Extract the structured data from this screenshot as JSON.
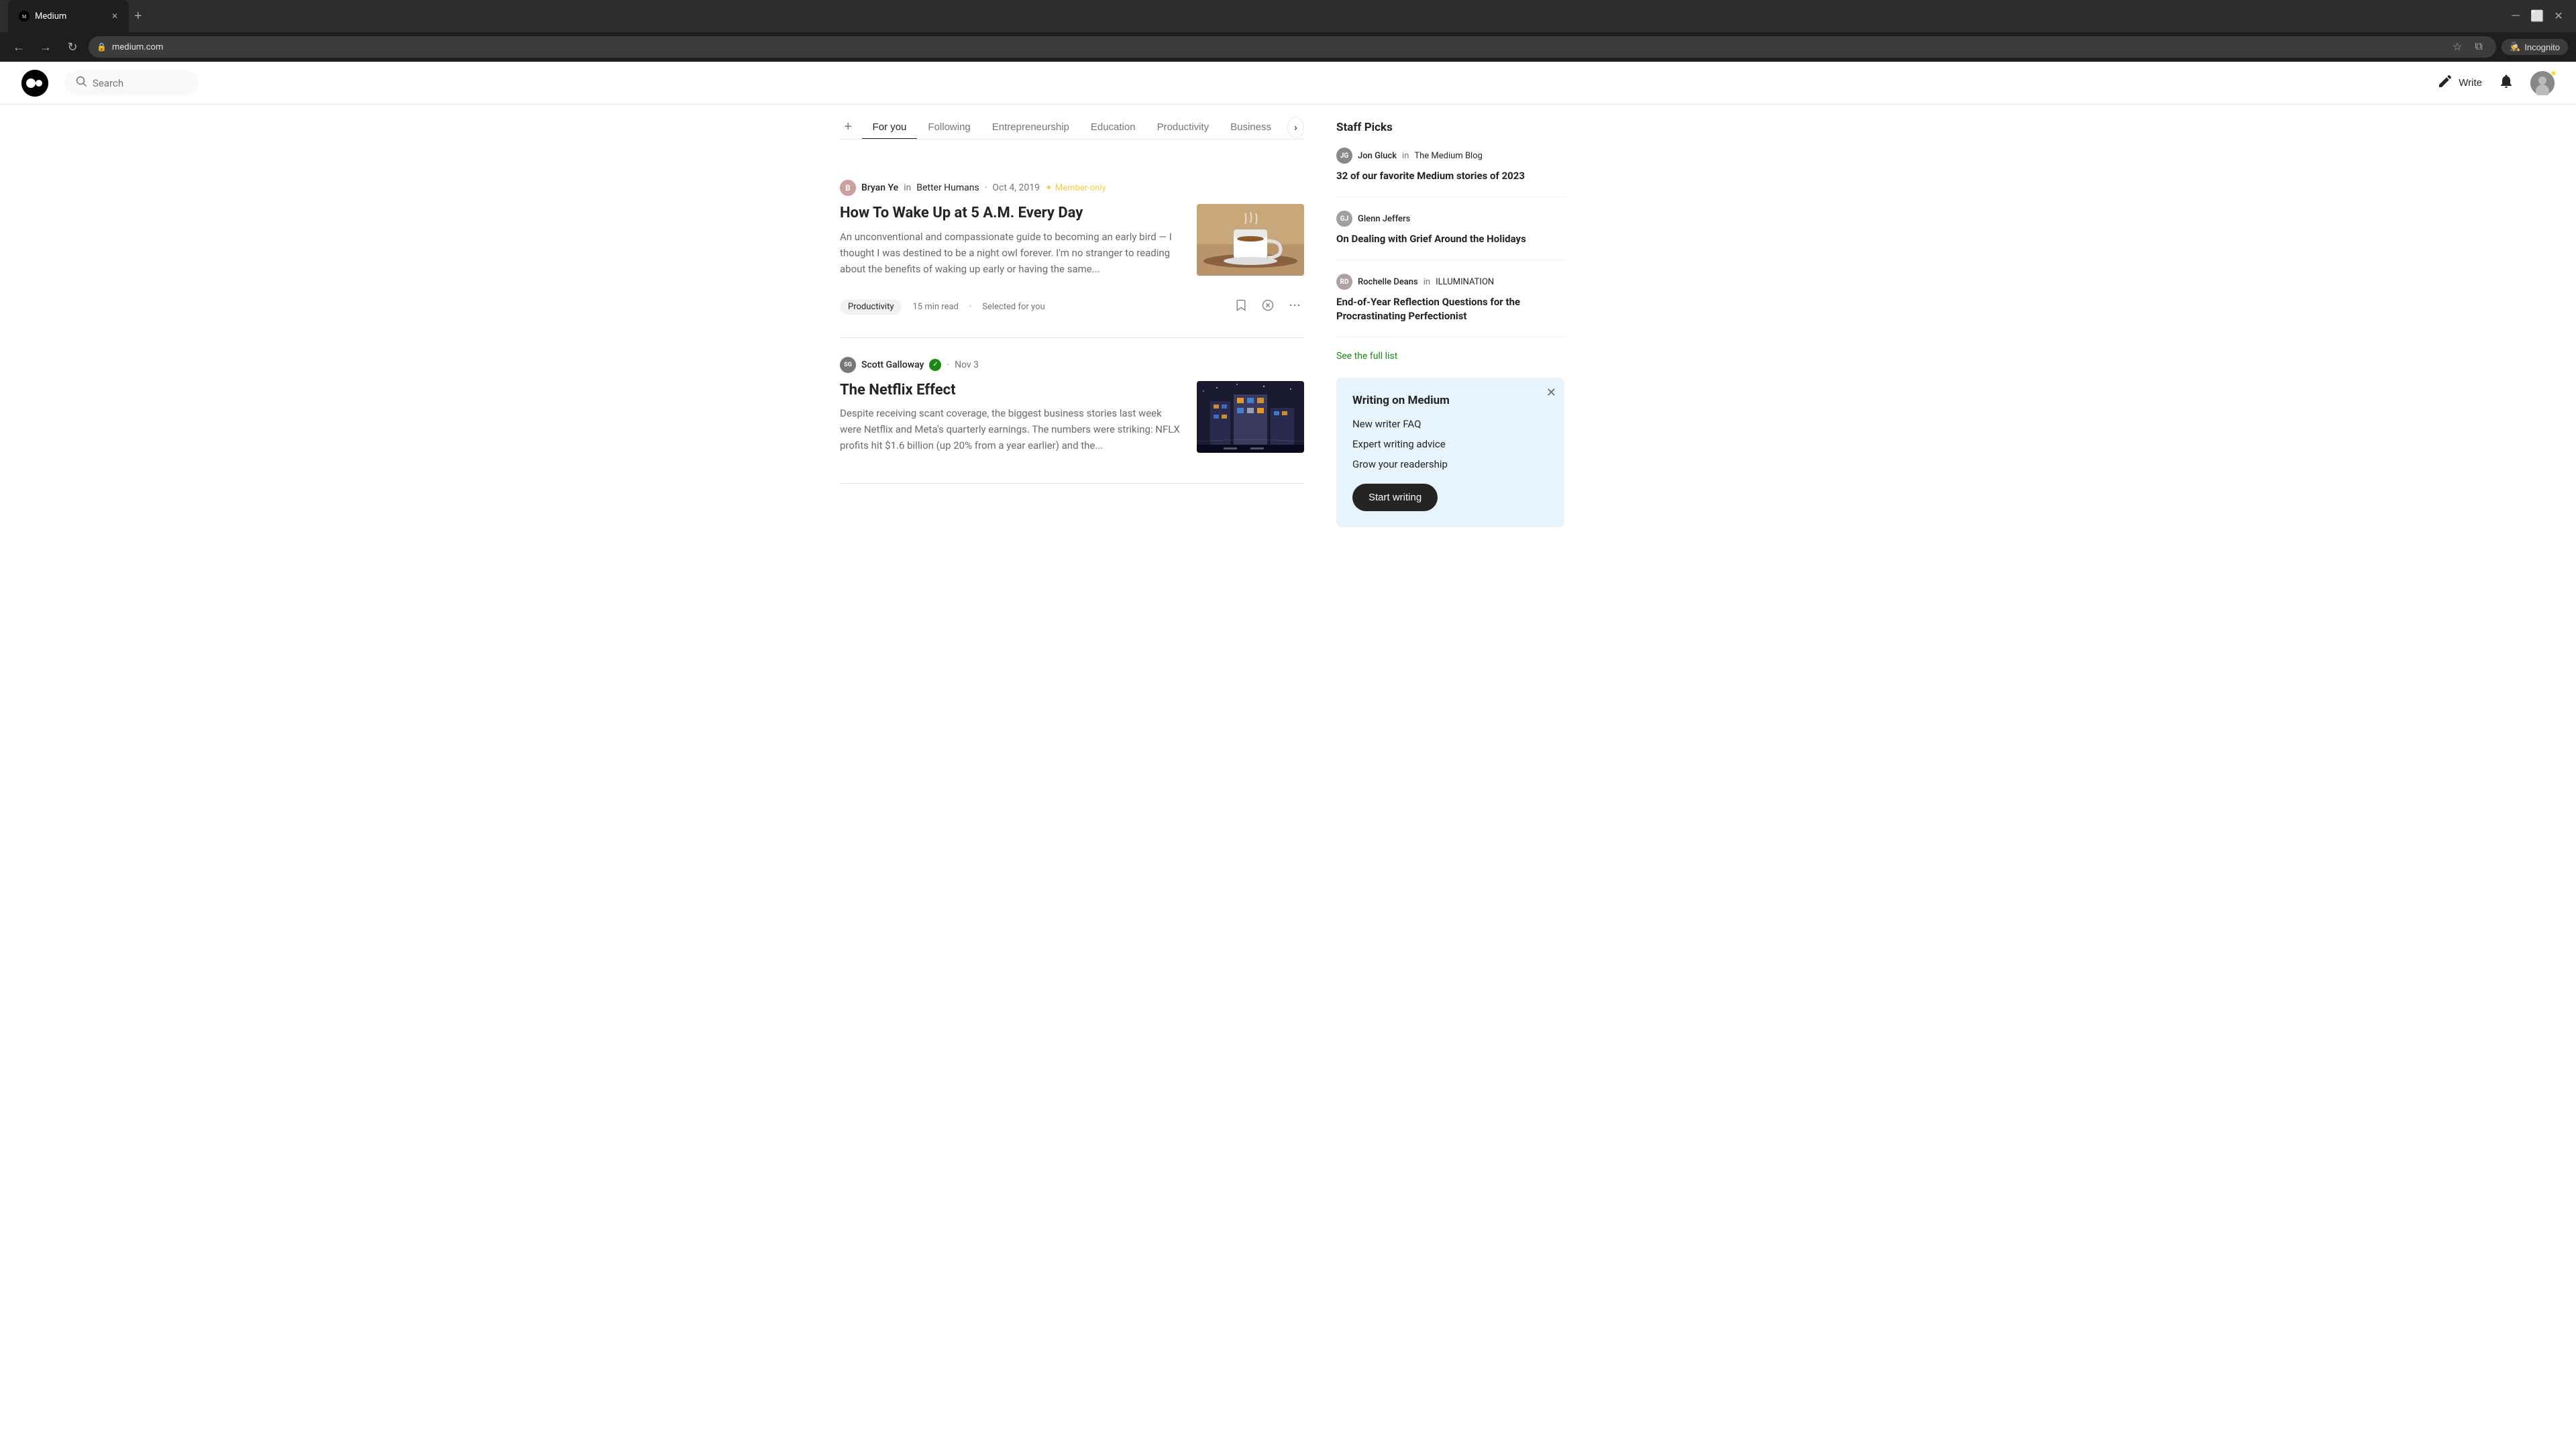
{
  "browser": {
    "tab_title": "Medium",
    "tab_favicon": "M",
    "url": "medium.com",
    "url_display": "medium.com",
    "incognito_label": "Incognito",
    "new_tab_label": "+"
  },
  "nav": {
    "search_placeholder": "Search",
    "write_label": "Write",
    "logo_mark": "M"
  },
  "feed_tabs": {
    "add_label": "+",
    "tabs": [
      {
        "label": "For you",
        "active": true
      },
      {
        "label": "Following",
        "active": false
      },
      {
        "label": "Entrepreneurship",
        "active": false
      },
      {
        "label": "Education",
        "active": false
      },
      {
        "label": "Productivity",
        "active": false
      },
      {
        "label": "Business",
        "active": false
      }
    ],
    "next_arrow": "›"
  },
  "articles": [
    {
      "author": "Bryan Ye",
      "author_initial": "B",
      "publication": "Better Humans",
      "date": "Oct 4, 2019",
      "member_badge": "Member-only",
      "title": "How To Wake Up at 5 A.M. Every Day",
      "excerpt": "An unconventional and compassionate guide to becoming an early bird — I thought I was destined to be a night owl forever. I'm no stranger to reading about the benefits of waking up early or having the same...",
      "tag": "Productivity",
      "read_time": "15 min read",
      "selected": "Selected for you",
      "dot_separator": "·"
    },
    {
      "author": "Scott Galloway",
      "author_initial": "SG",
      "publication": "",
      "date": "Nov 3",
      "verified": true,
      "title": "The Netflix Effect",
      "excerpt": "Despite receiving scant coverage, the biggest business stories last week were Netflix and Meta's quarterly earnings. The numbers were striking: NFLX profits hit $1.6 billion (up 20% from a year earlier) and the...",
      "tag": "",
      "read_time": "",
      "selected": ""
    }
  ],
  "sidebar": {
    "staff_picks_title": "Staff Picks",
    "picks": [
      {
        "author": "Jon Gluck",
        "author_initial": "JG",
        "pub_connector": "in",
        "publication": "The Medium Blog",
        "title": "32 of our favorite Medium stories of 2023",
        "avatar_bg": "#888"
      },
      {
        "author": "Glenn Jeffers",
        "author_initial": "GJ",
        "pub_connector": "",
        "publication": "",
        "title": "On Dealing with Grief Around the Holidays",
        "avatar_bg": "#a0a0a0"
      },
      {
        "author": "Rochelle Deans",
        "author_initial": "RD",
        "pub_connector": "in",
        "publication": "ILLUMINATION",
        "title": "End-of-Year Reflection Questions for the Procrastinating Perfectionist",
        "avatar_bg": "#b0a0a0"
      }
    ],
    "see_full_list": "See the full list",
    "writing_card": {
      "title": "Writing on Medium",
      "links": [
        "New writer FAQ",
        "Expert writing advice",
        "Grow your readership"
      ],
      "start_btn": "Start writing"
    }
  }
}
